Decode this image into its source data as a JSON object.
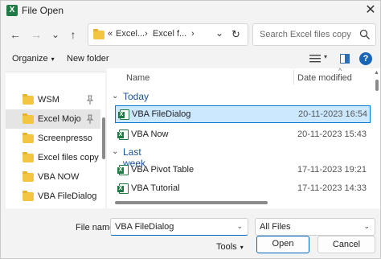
{
  "window": {
    "title": "File Open",
    "app_icon": "excel-icon",
    "close_glyph": "✕"
  },
  "nav": {
    "back_glyph": "←",
    "forward_glyph": "→",
    "recent_glyph": "⌄",
    "up_glyph": "↑",
    "address": {
      "overflow": "«",
      "crumb1": "Excel...",
      "sep1": "›",
      "crumb2": "Excel f...",
      "sep2": "›",
      "dropdown_glyph": "⌄",
      "refresh_glyph": "↻"
    },
    "search_placeholder": "Search Excel files copy"
  },
  "toolbar": {
    "organize_label": "Organize",
    "new_folder_label": "New folder",
    "caret_glyph": "▾"
  },
  "sidebar": {
    "items": [
      {
        "label": "WSM",
        "pinned": true,
        "selected": false
      },
      {
        "label": "Excel Mojo",
        "pinned": true,
        "selected": true
      },
      {
        "label": "Screenpresso",
        "pinned": false,
        "selected": false
      },
      {
        "label": "Excel files copy",
        "pinned": false,
        "selected": false
      },
      {
        "label": "VBA NOW",
        "pinned": false,
        "selected": false
      },
      {
        "label": "VBA FileDialog",
        "pinned": false,
        "selected": false
      }
    ],
    "pin_glyph": "📌"
  },
  "filelist": {
    "columns": {
      "name": "Name",
      "date": "Date modified",
      "sort_glyph": "^"
    },
    "groups": [
      {
        "label": "Today",
        "chevron": "⌄",
        "files": [
          {
            "name": "VBA FileDialog",
            "date": "20-11-2023 16:54",
            "selected": true
          },
          {
            "name": "VBA Now",
            "date": "20-11-2023 15:43",
            "selected": false
          }
        ]
      },
      {
        "label": "Last week",
        "chevron": "⌄",
        "files": [
          {
            "name": "VBA Pivot Table",
            "date": "17-11-2023 19:21",
            "selected": false
          },
          {
            "name": "VBA Tutorial",
            "date": "17-11-2023 14:33",
            "selected": false
          }
        ]
      }
    ],
    "scroll_up_glyph": "▲"
  },
  "bottom": {
    "file_name_label": "File name:",
    "file_name_value": "VBA FileDialog",
    "file_type_value": "All Files",
    "caret_glyph": "⌄",
    "tools_label": "Tools",
    "open_label": "Open",
    "cancel_label": "Cancel"
  },
  "colors": {
    "excel_green": "#1f7a45",
    "selection_fill": "#cce8ff",
    "selection_border": "#0078d4",
    "group_header": "#1a4f95",
    "folder_yellow": "#f4c542"
  }
}
